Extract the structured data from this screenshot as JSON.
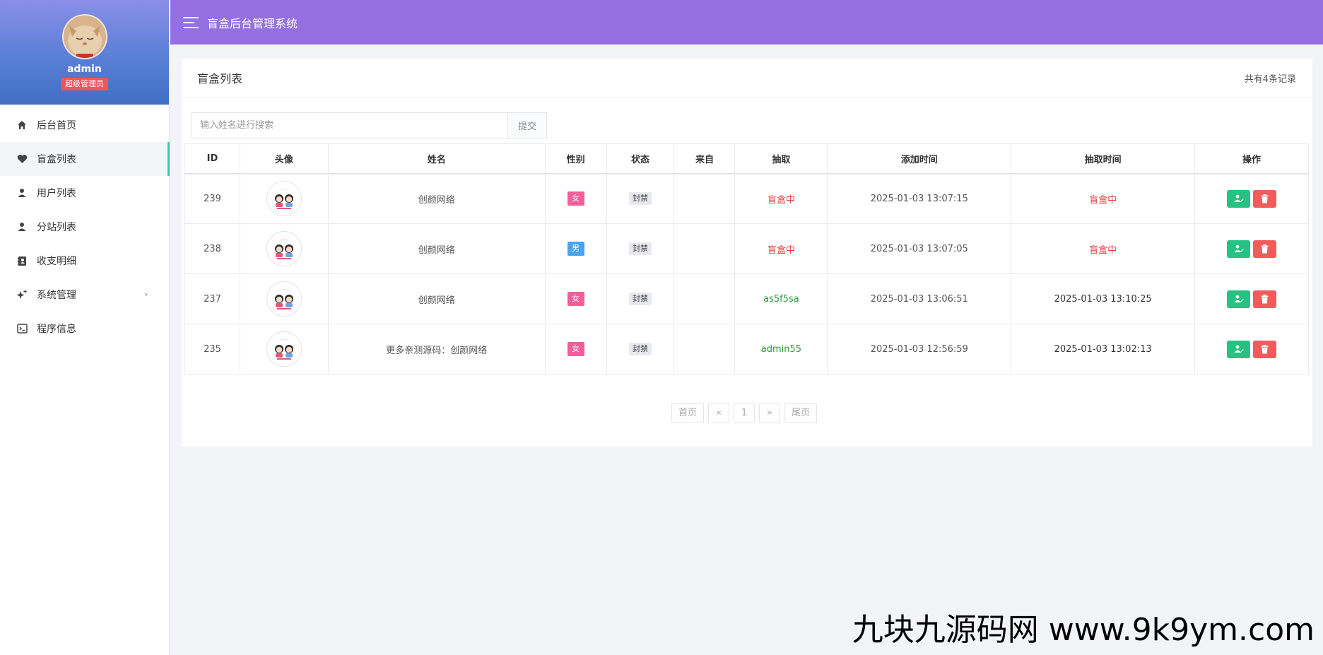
{
  "app": {
    "title": "盲盒后台管理系统"
  },
  "profile": {
    "name": "admin",
    "role": "超级管理员"
  },
  "sidebar": {
    "items": [
      {
        "label": "后台首页",
        "icon": "home-icon",
        "active": false
      },
      {
        "label": "盲盒列表",
        "icon": "heart-icon",
        "active": true
      },
      {
        "label": "用户列表",
        "icon": "user-icon",
        "active": false
      },
      {
        "label": "分站列表",
        "icon": "user-icon",
        "active": false
      },
      {
        "label": "收支明细",
        "icon": "ledger-icon",
        "active": false
      },
      {
        "label": "系统管理",
        "icon": "sparkle-icon",
        "active": false,
        "has_submenu": true
      },
      {
        "label": "程序信息",
        "icon": "terminal-icon",
        "active": false
      }
    ]
  },
  "card": {
    "title": "盲盒列表",
    "count": "共有4条记录"
  },
  "search": {
    "placeholder": "输入姓名进行搜索",
    "value": "",
    "submit_label": "提交"
  },
  "table": {
    "headers": [
      "ID",
      "头像",
      "姓名",
      "性别",
      "状态",
      "来自",
      "抽取",
      "添加时间",
      "抽取时间",
      "操作"
    ],
    "rows": [
      {
        "id": "239",
        "name": "创颜网络",
        "sex": "女",
        "sex_type": "female",
        "status": "封禁",
        "from": "",
        "draw": "盲盒中",
        "draw_color": "red",
        "added": "2025-01-03 13:07:15",
        "draw_time": "盲盒中",
        "draw_time_color": "red"
      },
      {
        "id": "238",
        "name": "创颜网络",
        "sex": "男",
        "sex_type": "male",
        "status": "封禁",
        "from": "",
        "draw": "盲盒中",
        "draw_color": "red",
        "added": "2025-01-03 13:07:05",
        "draw_time": "盲盒中",
        "draw_time_color": "red"
      },
      {
        "id": "237",
        "name": "创颜网络",
        "sex": "女",
        "sex_type": "female",
        "status": "封禁",
        "from": "",
        "draw": "as5f5sa",
        "draw_color": "green",
        "added": "2025-01-03 13:06:51",
        "draw_time": "2025-01-03 13:10:25",
        "draw_time_color": "dark"
      },
      {
        "id": "235",
        "name": "更多亲测源码：创颜网络",
        "sex": "女",
        "sex_type": "female",
        "status": "封禁",
        "from": "",
        "draw": "admin55",
        "draw_color": "green",
        "added": "2025-01-03 12:56:59",
        "draw_time": "2025-01-03 13:02:13",
        "draw_time_color": "dark"
      }
    ]
  },
  "pagination": {
    "first": "首页",
    "prev": "«",
    "current": "1",
    "next": "»",
    "last": "尾页"
  },
  "watermark": "九块九源码网 www.9k9ym.com",
  "colors": {
    "header": "#9470e0",
    "active_bar": "#36c6b8",
    "role_badge": "#f1535f",
    "edit_button": "#26c281",
    "delete_button": "#f15b5b"
  }
}
